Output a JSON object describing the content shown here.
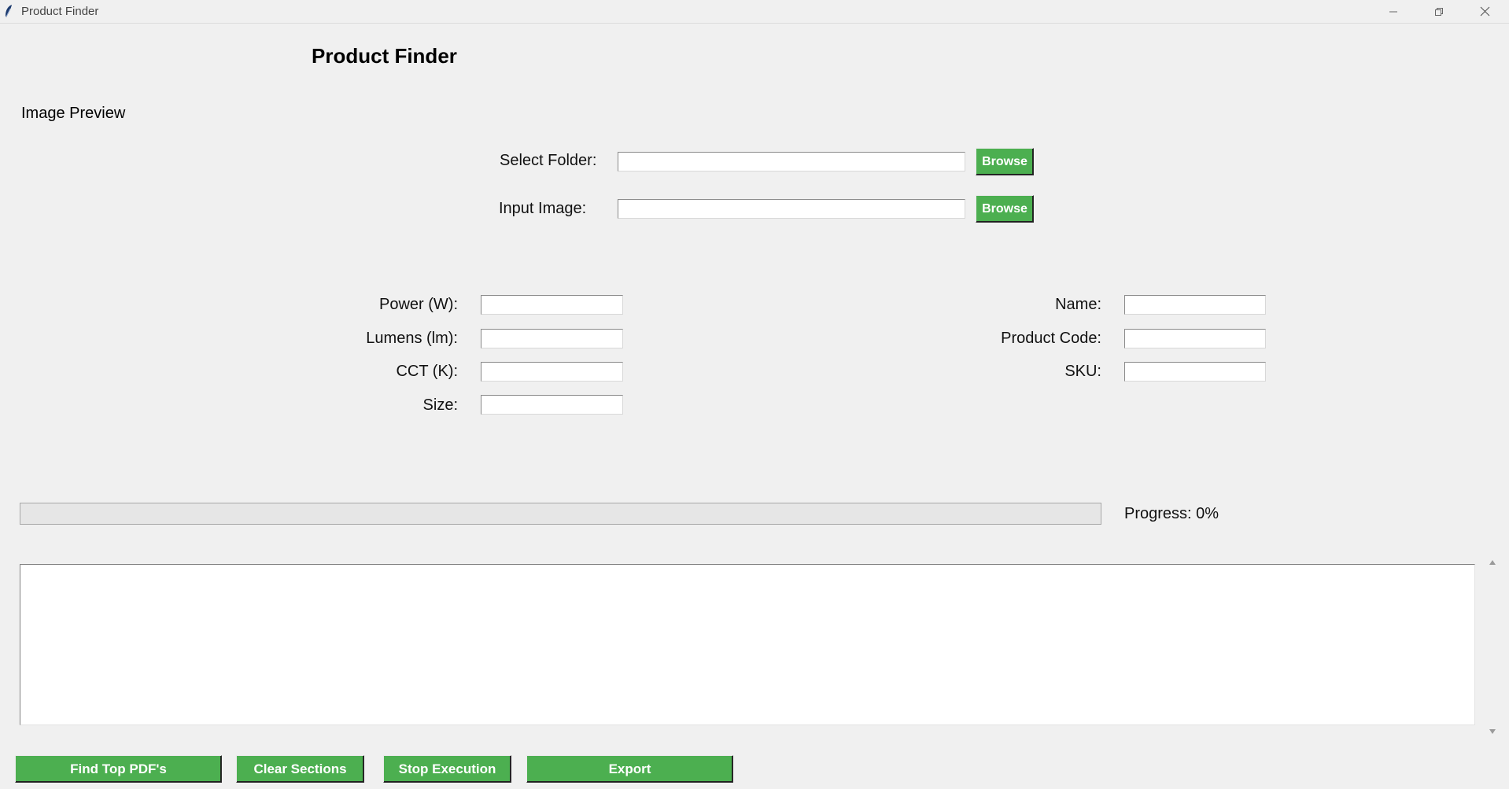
{
  "window": {
    "title": "Product Finder"
  },
  "header": {
    "title": "Product Finder"
  },
  "preview": {
    "label": "Image Preview"
  },
  "files": {
    "select_folder_label": "Select Folder:",
    "select_folder_value": "",
    "input_image_label": "Input Image:",
    "input_image_value": "",
    "browse_label": "Browse"
  },
  "filters": {
    "power_label": "Power (W):",
    "power_value": "",
    "lumens_label": "Lumens (lm):",
    "lumens_value": "",
    "cct_label": "CCT (K):",
    "cct_value": "",
    "size_label": "Size:",
    "size_value": "",
    "name_label": "Name:",
    "name_value": "",
    "product_code_label": "Product Code:",
    "product_code_value": "",
    "sku_label": "SKU:",
    "sku_value": ""
  },
  "progress": {
    "label": "Progress: 0%",
    "value": 0
  },
  "log": {
    "text": ""
  },
  "actions": {
    "find_label": "Find Top PDF's",
    "clear_label": "Clear Sections",
    "stop_label": "Stop Execution",
    "export_label": "Export"
  },
  "colors": {
    "button_green": "#4caf50",
    "window_bg": "#f0f0f0"
  },
  "icons": {
    "app": "feather-icon",
    "minimize": "minimize-icon",
    "maximize": "restore-icon",
    "close": "close-icon",
    "scroll_up": "scroll-up-arrow-icon",
    "scroll_down": "scroll-down-arrow-icon"
  }
}
